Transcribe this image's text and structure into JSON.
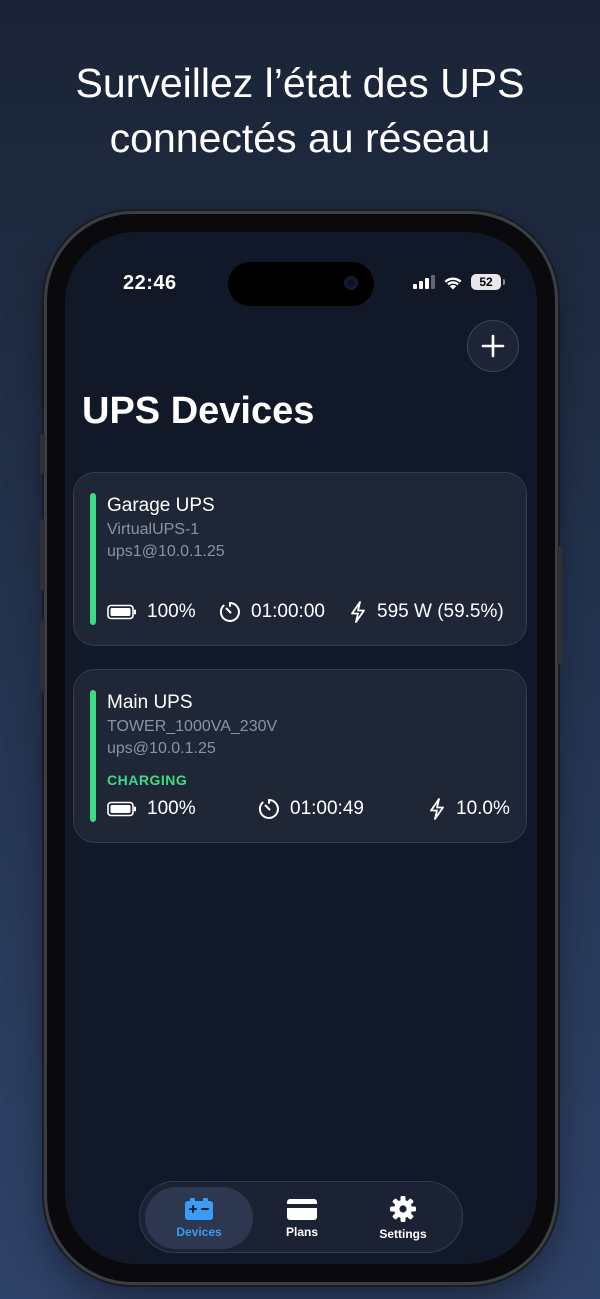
{
  "marketing": {
    "line1": "Surveillez l’état des UPS",
    "line2": "connectés au réseau"
  },
  "status_bar": {
    "time": "22:46",
    "battery": "52"
  },
  "page": {
    "title": "UPS Devices"
  },
  "devices": [
    {
      "name": "Garage UPS",
      "model": "VirtualUPS-1",
      "address": "ups1@10.0.1.25",
      "state": "",
      "charge": "100%",
      "runtime": "01:00:00",
      "load": "595 W (59.5%)"
    },
    {
      "name": "Main UPS",
      "model": "TOWER_1000VA_230V",
      "address": "ups@10.0.1.25",
      "state": "CHARGING",
      "charge": "100%",
      "runtime": "01:00:49",
      "load": "10.0%"
    }
  ],
  "tabs": [
    {
      "label": "Devices",
      "icon": "battery-icon",
      "active": true
    },
    {
      "label": "Plans",
      "icon": "credit-card-icon",
      "active": false
    },
    {
      "label": "Settings",
      "icon": "gear-icon",
      "active": false
    }
  ],
  "colors": {
    "accent": "#3b9cf5",
    "status_ok": "#3ddc84",
    "card_bg": "#1f2636",
    "screen_bg": "#111827"
  }
}
